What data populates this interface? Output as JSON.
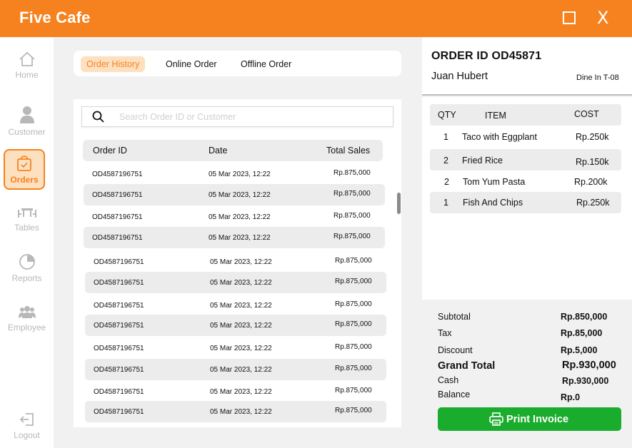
{
  "app": {
    "title": "Five Cafe",
    "close_glyph": "X"
  },
  "colors": {
    "brand": "#f6821f",
    "accent_light": "#fde0bf",
    "success": "#1aac2c"
  },
  "sidebar": {
    "items": [
      {
        "label": "Home",
        "icon": "home-icon",
        "active": false
      },
      {
        "label": "Customer",
        "icon": "user-icon",
        "active": false
      },
      {
        "label": "Orders",
        "icon": "orders-bag-icon",
        "active": true
      },
      {
        "label": "Tables",
        "icon": "table-icon",
        "active": false
      },
      {
        "label": "Reports",
        "icon": "reports-chart-icon",
        "active": false
      },
      {
        "label": "Employee",
        "icon": "employees-icon",
        "active": false
      }
    ],
    "logout": {
      "label": "Logout",
      "icon": "logout-icon"
    }
  },
  "tabs": [
    {
      "label": "Order History",
      "active": true
    },
    {
      "label": "Online Order",
      "active": false
    },
    {
      "label": "Offline Order",
      "active": false
    }
  ],
  "search": {
    "placeholder": "Search Order ID or Customer",
    "icon": "search-icon"
  },
  "orders": {
    "columns": [
      "Order ID",
      "Date",
      "Total Sales"
    ],
    "rows": [
      {
        "id": "OD4587196751",
        "date": "05 Mar 2023, 12:22",
        "total": "Rp.875,000"
      },
      {
        "id": "OD4587196751",
        "date": "05 Mar 2023, 12:22",
        "total": "Rp.875,000"
      },
      {
        "id": "OD4587196751",
        "date": "05 Mar 2023, 12:22",
        "total": "Rp.875,000"
      },
      {
        "id": "OD4587196751",
        "date": "05 Mar 2023, 12:22",
        "total": "Rp.875,000"
      },
      {
        "id": "OD4587196751",
        "date": "05 Mar 2023, 12:22",
        "total": "Rp.875,000"
      },
      {
        "id": "OD4587196751",
        "date": "05 Mar 2023, 12:22",
        "total": "Rp.875,000"
      },
      {
        "id": "OD4587196751",
        "date": "05 Mar 2023, 12:22",
        "total": "Rp.875,000"
      },
      {
        "id": "OD4587196751",
        "date": "05 Mar 2023, 12:22",
        "total": "Rp.875,000"
      },
      {
        "id": "OD4587196751",
        "date": "05 Mar 2023, 12:22",
        "total": "Rp.875,000"
      },
      {
        "id": "OD4587196751",
        "date": "05 Mar 2023, 12:22",
        "total": "Rp.875,000"
      },
      {
        "id": "OD4587196751",
        "date": "05 Mar 2023, 12:22",
        "total": "Rp.875,000"
      },
      {
        "id": "OD4587196751",
        "date": "05 Mar 2023, 12:22",
        "total": "Rp.875,000"
      }
    ]
  },
  "order_detail": {
    "title": "ORDER ID OD45871",
    "customer": "Juan Hubert",
    "dine": "Dine In T-08",
    "columns": [
      "QTY",
      "ITEM",
      "COST"
    ],
    "items": [
      {
        "qty": "1",
        "name": "Taco with Eggplant",
        "cost": "Rp.250k"
      },
      {
        "qty": "2",
        "name": "Fried Rice",
        "cost": "Rp.150k"
      },
      {
        "qty": "2",
        "name": "Tom Yum Pasta",
        "cost": "Rp.200k"
      },
      {
        "qty": "1",
        "name": "Fish And Chips",
        "cost": "Rp.250k"
      }
    ]
  },
  "summary": {
    "subtotal_label": "Subtotal",
    "subtotal": "Rp.850,000",
    "tax_label": "Tax",
    "tax": "Rp.85,000",
    "discount_label": "Discount",
    "discount": "Rp.5,000",
    "grand_total_label": "Grand Total",
    "grand_total": "Rp.930,000",
    "cash_label": "Cash",
    "cash": "Rp.930,000",
    "balance_label": "Balance",
    "balance": "Rp.0"
  },
  "print_button": {
    "label": "Print Invoice",
    "icon": "printer-icon"
  }
}
